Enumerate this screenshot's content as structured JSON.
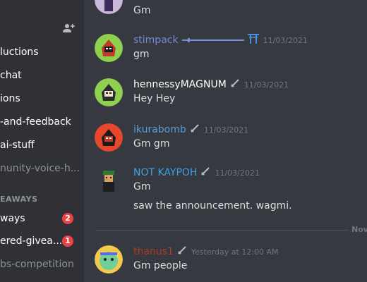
{
  "sidebar": {
    "channels": [
      {
        "label": "luctions"
      },
      {
        "label": "chat"
      },
      {
        "label": "ions"
      },
      {
        "label": "-and-feedback"
      },
      {
        "label": "ai-stuff"
      },
      {
        "label": "nunity-voice-h..."
      }
    ],
    "category_label": "EAWAYS",
    "channels2": [
      {
        "label": "ways",
        "badge": "2"
      },
      {
        "label": "ered-givea...",
        "badge": "1"
      },
      {
        "label": "bs-competition"
      }
    ]
  },
  "messages": [
    {
      "username": "",
      "timestamp": "",
      "text": "Gm",
      "name_color": "#ffffff"
    },
    {
      "username": "stimpack",
      "timestamp": "11/03/2021",
      "text": "gm",
      "name_color": "#7289da"
    },
    {
      "username": "hennessyMAGNUM",
      "timestamp": "11/03/2021",
      "text": "Hey Hey",
      "name_color": "#ffffff"
    },
    {
      "username": "ikurabomb",
      "timestamp": "11/03/2021",
      "text": "Gm gm",
      "name_color": "#5a9bd8"
    },
    {
      "username": "NOT KAYPOH",
      "timestamp": "11/03/2021",
      "text": "Gm",
      "text2": "saw the announcement. wagmi.",
      "name_color": "#3fa0e6"
    },
    {
      "username": "thanus1",
      "timestamp": "Yesterday at 12:00 AM",
      "text": "Gm people",
      "name_color": "#ad3b2a"
    }
  ],
  "divider_label": "Nove",
  "colors": {
    "accent": "#7289da",
    "badge": "#ed4245",
    "sidebar_bg": "#2f3136",
    "chat_bg": "#36393f"
  },
  "icons": [
    "add-friend-icon",
    "sword-icon",
    "torii-gate-icon"
  ]
}
